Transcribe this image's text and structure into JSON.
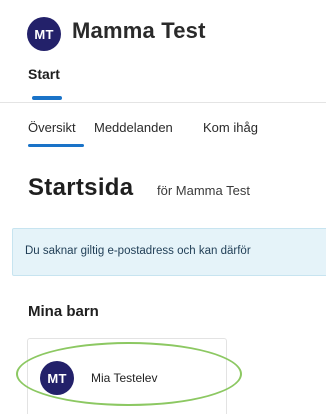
{
  "header": {
    "avatar_initials": "MT",
    "user_name": "Mamma Test"
  },
  "nav": {
    "items": [
      {
        "label": "Start",
        "active": true
      }
    ]
  },
  "subtabs": [
    {
      "label": "Översikt",
      "active": true
    },
    {
      "label": "Meddelanden",
      "active": false
    },
    {
      "label": "Kom ihåg",
      "active": false
    }
  ],
  "page": {
    "title": "Startsida",
    "subtitle": "för Mamma Test"
  },
  "alert": {
    "text": "Du saknar giltig e-postadress och kan därför"
  },
  "children": {
    "heading": "Mina barn",
    "items": [
      {
        "initials": "MT",
        "name": "Mia Testelev"
      }
    ]
  },
  "colors": {
    "avatar_bg": "#23216a",
    "accent": "#1a73c8",
    "alert_bg": "#e5f3f9",
    "highlight": "#8cc862"
  }
}
